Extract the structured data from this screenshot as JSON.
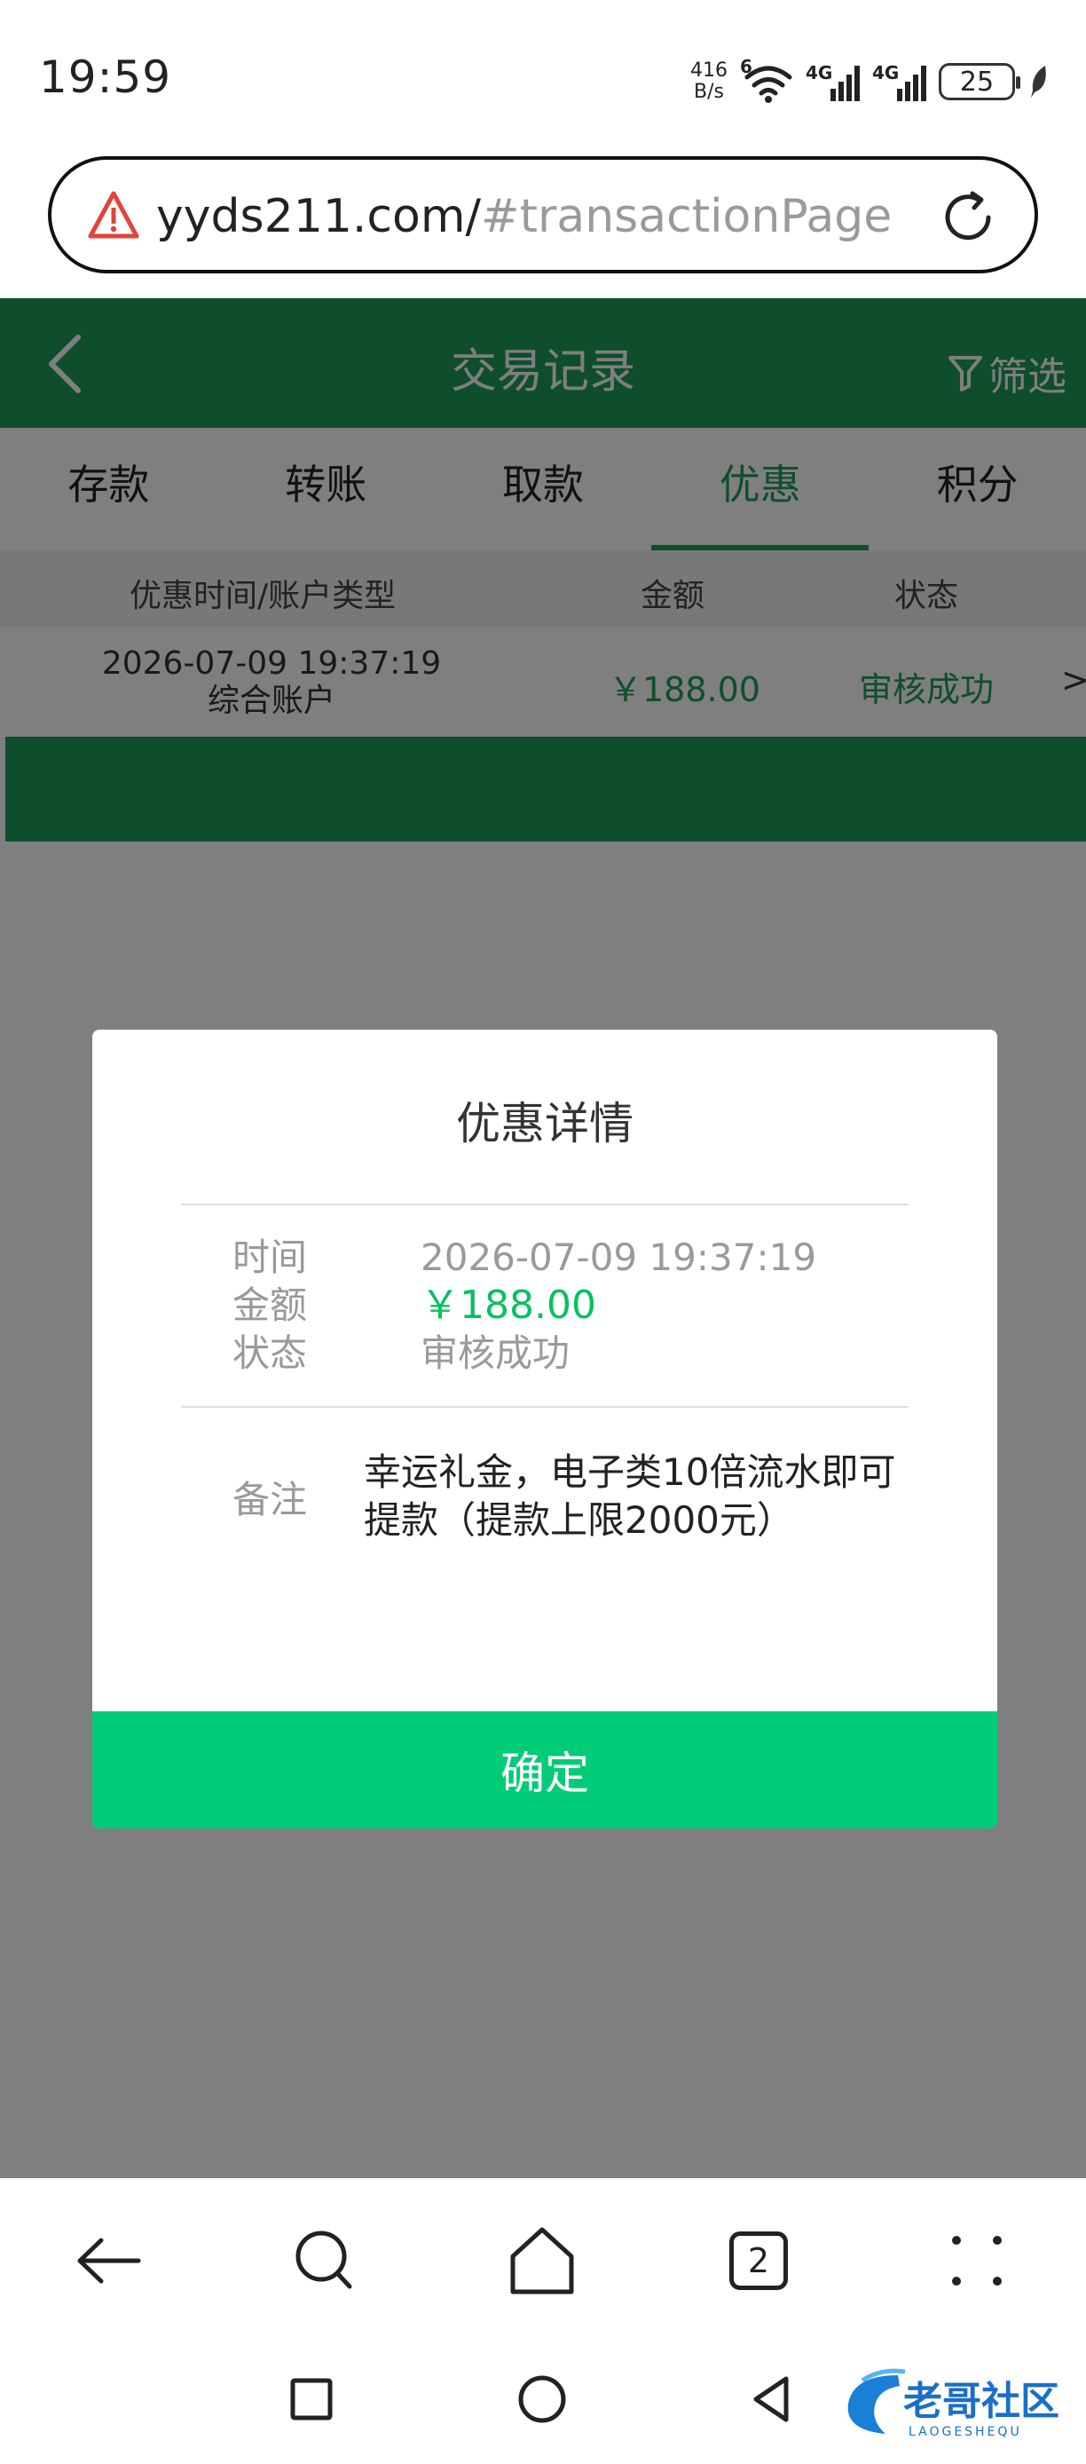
{
  "status_bar": {
    "time": "19:59",
    "net_speed_value": "416",
    "net_speed_unit": "B/s",
    "wifi_tag": "6",
    "signal1_tag": "4G",
    "signal2_tag": "4G",
    "battery": "25"
  },
  "url_bar": {
    "host": "yyds211.com/",
    "hash": "#transactionPage"
  },
  "header": {
    "title": "交易记录",
    "filter_label": "筛选"
  },
  "tabs": [
    {
      "label": "存款",
      "active": false
    },
    {
      "label": "转账",
      "active": false
    },
    {
      "label": "取款",
      "active": false
    },
    {
      "label": "优惠",
      "active": true
    },
    {
      "label": "积分",
      "active": false
    }
  ],
  "table": {
    "headers": {
      "time_account": "优惠时间/账户类型",
      "amount": "金额",
      "status": "状态"
    },
    "rows": [
      {
        "time": "2026-07-09 19:37:19",
        "account": "综合账户",
        "amount": "￥188.00",
        "status": "审核成功",
        "arrow": ">"
      }
    ]
  },
  "modal": {
    "title": "优惠详情",
    "time_label": "时间",
    "time_value": "2026-07-09 19:37:19",
    "amount_label": "金额",
    "amount_value": "￥188.00",
    "status_label": "状态",
    "status_value": "审核成功",
    "note_label": "备注",
    "note_value": "幸运礼金，电子类10倍流水即可提款（提款上限2000元）",
    "confirm_label": "确定"
  },
  "toolbar": {
    "tab_count": "2"
  },
  "watermark": {
    "text": "老哥社区",
    "subtext": "LAOGESHEQU"
  },
  "colors": {
    "brand_green": "#1e9c5a",
    "confirm_green": "#00cc77",
    "amount_green": "#07c160",
    "warning_red": "#e0443a"
  }
}
